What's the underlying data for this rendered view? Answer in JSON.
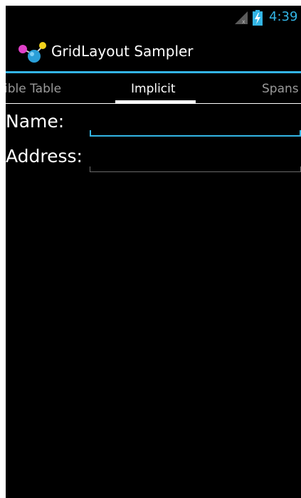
{
  "status_bar": {
    "time": "4:39",
    "accent_color": "#33b5e5",
    "icons": [
      "signal-no-sim-icon",
      "battery-charging-icon"
    ]
  },
  "action_bar": {
    "app_icon": "gridlayout-molecule-icon",
    "title": "GridLayout Sampler",
    "divider_color": "#33b5e5"
  },
  "tabs": [
    {
      "label": "ible Table",
      "selected": false
    },
    {
      "label": "Implicit",
      "selected": true
    },
    {
      "label": "Spans",
      "selected": false
    }
  ],
  "form": {
    "name": {
      "label": "Name:",
      "value": "",
      "focused": true
    },
    "address": {
      "label": "Address:",
      "value": "",
      "focused": false
    }
  }
}
